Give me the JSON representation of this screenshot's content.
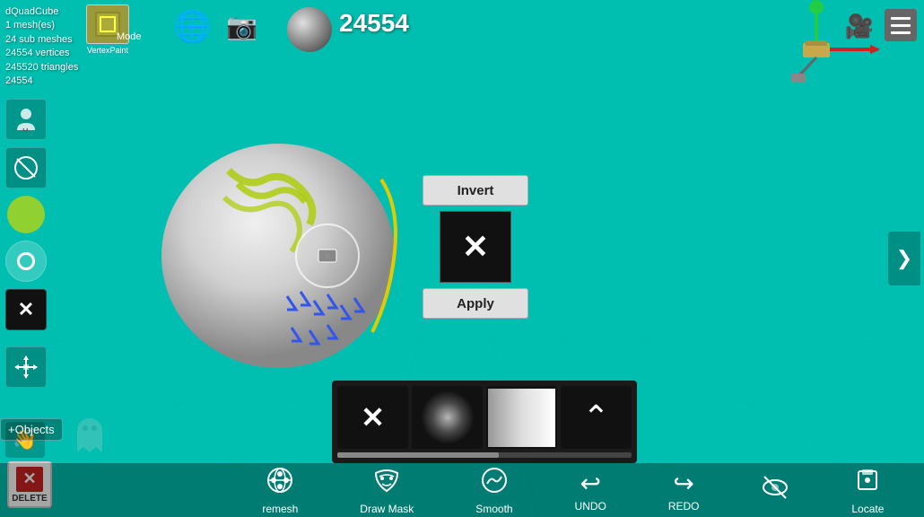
{
  "app": {
    "title": "dQuadCube",
    "mesh_count": "1 mesh(es)",
    "sub_meshes": "24 sub meshes",
    "vertices": "24554 vertices",
    "triangles": "245520 triangles",
    "count_label": "24554",
    "counter": "24554"
  },
  "toolbar": {
    "vertex_paint_label": "VertexPaint",
    "mode_label": "Mode",
    "invert_label": "Invert",
    "apply_label": "Apply",
    "smooth_label": "Smooth",
    "remesh_label": "remesh",
    "draw_mask_label": "Draw Mask",
    "undo_label": "UNDO",
    "redo_label": "REDO",
    "locate_label": "Locate",
    "delete_label": "DELETE",
    "objects_label": "+Objects"
  },
  "brushes": [
    {
      "name": "x-brush",
      "type": "x"
    },
    {
      "name": "cloud-brush",
      "type": "cloud"
    },
    {
      "name": "gradient-brush",
      "type": "gradient"
    },
    {
      "name": "chevron-brush",
      "type": "chevron"
    }
  ],
  "colors": {
    "bg": "#00bfb0",
    "toolbar_bg": "rgba(0,0,0,0.35)",
    "accent": "#00d4c4",
    "delete_red": "#cc2222"
  },
  "icons": {
    "hamburger": "≡",
    "globe": "🌐",
    "camera_snap": "📷",
    "video_cam": "🎥",
    "pencil_slash": "⊘",
    "circle_dot": "○",
    "move_arrows": "⊕",
    "hand_icon": "👋",
    "right_chevron": "❯",
    "undo": "↩",
    "redo": "↪",
    "eye_slash": "👁",
    "cursor": "⬆"
  },
  "progress": {
    "value": 55
  }
}
